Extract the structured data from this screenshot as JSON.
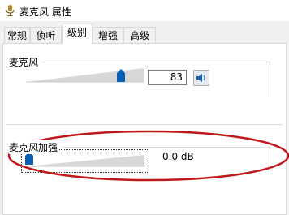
{
  "window": {
    "title": "麦克风 属性"
  },
  "tabs": [
    {
      "label": "常规"
    },
    {
      "label": "侦听"
    },
    {
      "label": "级别"
    },
    {
      "label": "增强"
    },
    {
      "label": "高级"
    }
  ],
  "active_tab": "级别",
  "microphone": {
    "label": "麦克风",
    "value": "83",
    "level_percent": 83,
    "icon": "speaker-icon"
  },
  "boost": {
    "label": "麦克风加强",
    "value": "0.0 dB",
    "level_percent": 0
  },
  "colors": {
    "accent": "#0a5fb4",
    "annotation": "#c0191b"
  }
}
